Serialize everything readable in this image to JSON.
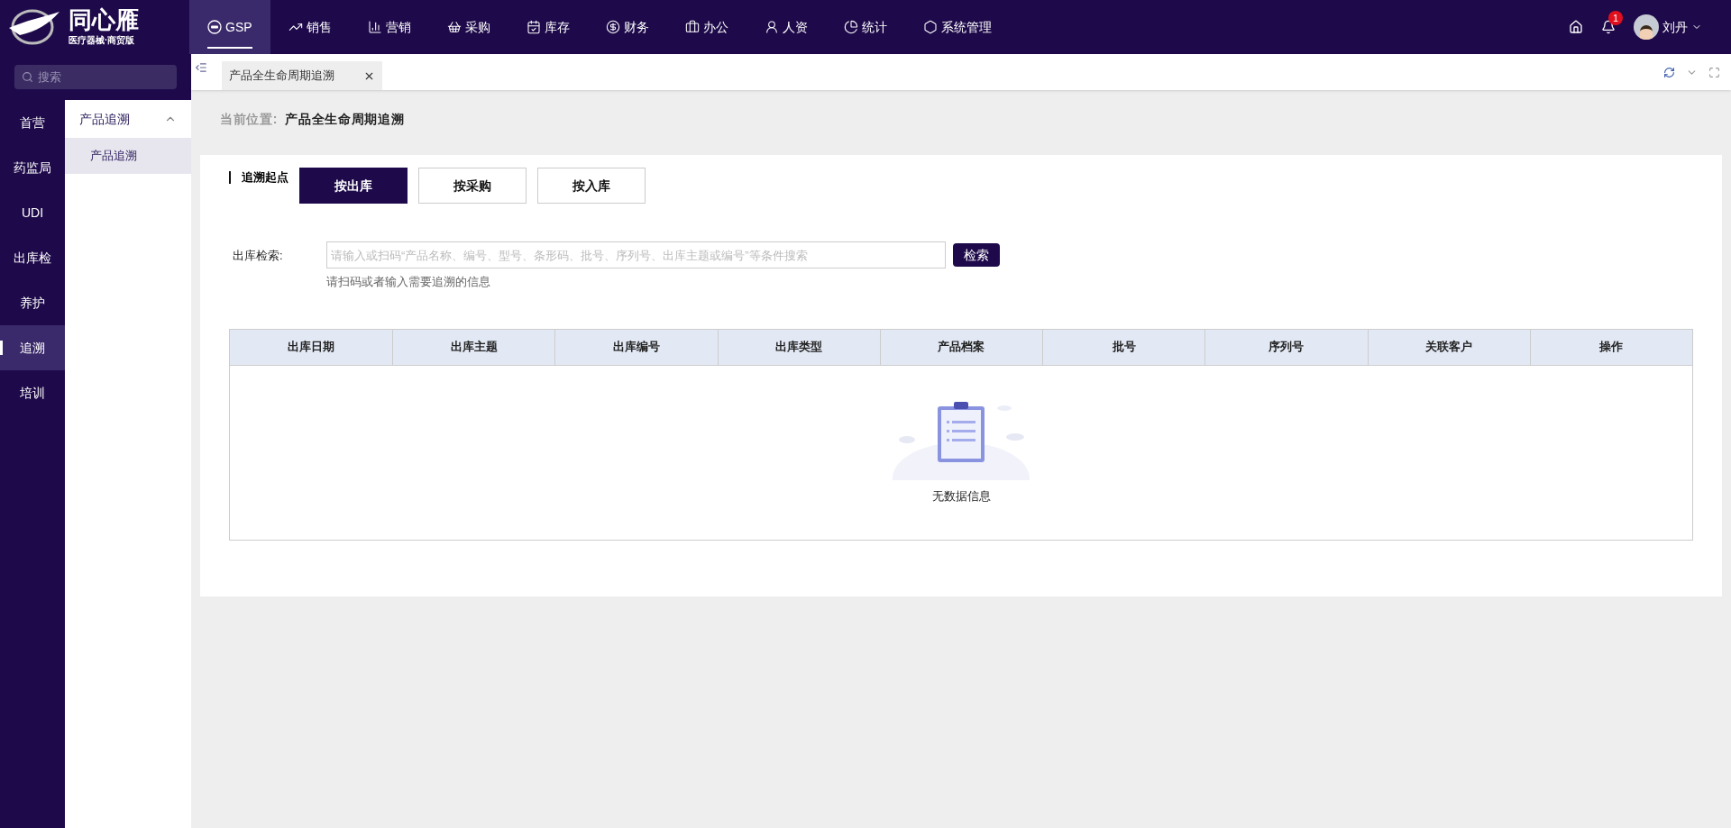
{
  "logo": {
    "name": "同心雁",
    "subtitle": "医疗器械·商贸版"
  },
  "top_nav": [
    {
      "label": "GSP",
      "selected": true
    },
    {
      "label": "销售",
      "selected": false
    },
    {
      "label": "营销",
      "selected": false
    },
    {
      "label": "采购",
      "selected": false
    },
    {
      "label": "库存",
      "selected": false
    },
    {
      "label": "财务",
      "selected": false
    },
    {
      "label": "办公",
      "selected": false
    },
    {
      "label": "人资",
      "selected": false
    },
    {
      "label": "统计",
      "selected": false
    },
    {
      "label": "系统管理",
      "selected": false
    }
  ],
  "header_right": {
    "notification_count": "1",
    "user": "刘丹"
  },
  "search": {
    "placeholder": "搜索"
  },
  "rail": [
    {
      "label": "首营",
      "selected": false
    },
    {
      "label": "药监局",
      "selected": false
    },
    {
      "label": "UDI",
      "selected": false
    },
    {
      "label": "出库检",
      "selected": false
    },
    {
      "label": "养护",
      "selected": false
    },
    {
      "label": "追溯",
      "selected": true
    },
    {
      "label": "培训",
      "selected": false
    }
  ],
  "submenu": {
    "title": "产品追溯",
    "expanded": true,
    "items": [
      {
        "label": "产品追溯",
        "selected": true
      }
    ]
  },
  "page_tabs": [
    {
      "label": "产品全生命周期追溯",
      "selected": true
    }
  ],
  "breadcrumb": {
    "label": "当前位置:",
    "current": "产品全生命周期追溯"
  },
  "trace_start": {
    "label": "追溯起点",
    "options": [
      {
        "label": "按出库",
        "selected": true
      },
      {
        "label": "按采购",
        "selected": false
      },
      {
        "label": "按入库",
        "selected": false
      }
    ]
  },
  "search_form": {
    "label": "出库检索:",
    "placeholder": "请输入或扫码“产品名称、编号、型号、条形码、批号、序列号、出库主题或编号”等条件搜索",
    "button": "检索",
    "hint": "请扫码或者输入需要追溯的信息"
  },
  "table": {
    "columns": [
      "出库日期",
      "出库主题",
      "出库编号",
      "出库类型",
      "产品档案",
      "批号",
      "序列号",
      "关联客户",
      "操作"
    ],
    "empty_text": "无数据信息"
  }
}
